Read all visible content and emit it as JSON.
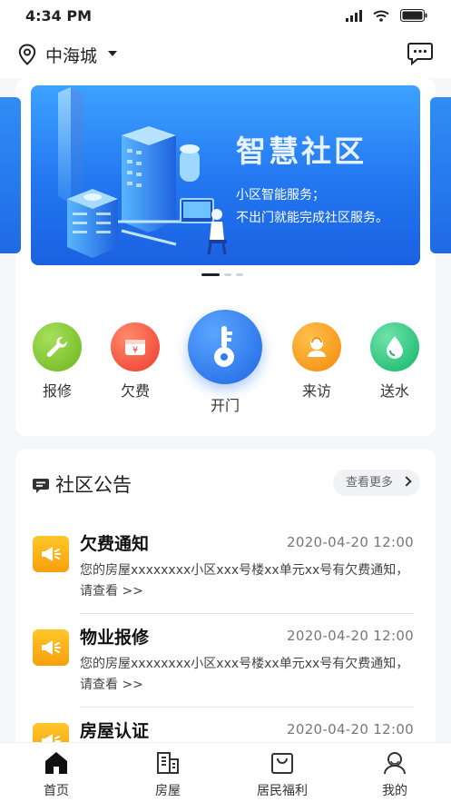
{
  "status": {
    "time": "4:34 PM"
  },
  "header": {
    "location": "中海城"
  },
  "banner": {
    "title": "智慧社区",
    "line1": "小区智能服务；",
    "line2": "不出门就能完成社区服务。"
  },
  "functions": [
    {
      "label": "报修",
      "color": "#7dc12a"
    },
    {
      "label": "欠费",
      "color": "#f5543a"
    },
    {
      "label": "开门",
      "color": "#2f7df3"
    },
    {
      "label": "来访",
      "color": "#f7a00c"
    },
    {
      "label": "送水",
      "color": "#27c17a"
    }
  ],
  "notices": {
    "title": "社区公告",
    "more": "查看更多",
    "items": [
      {
        "title": "欠费通知",
        "date": "2020-04-20  12:00",
        "body": "您的房屋xxxxxxxx小区xxx号楼xx单元xx号有欠费通知，请查看  >>"
      },
      {
        "title": "物业报修",
        "date": "2020-04-20  12:00",
        "body": "您的房屋xxxxxxxx小区xxx号楼xx单元xx号有欠费通知，请查看  >>"
      },
      {
        "title": "房屋认证",
        "date": "2020-04-20  12:00",
        "body": ""
      }
    ]
  },
  "tabs": [
    {
      "label": "首页"
    },
    {
      "label": "房屋"
    },
    {
      "label": "居民福利"
    },
    {
      "label": "我的"
    }
  ]
}
